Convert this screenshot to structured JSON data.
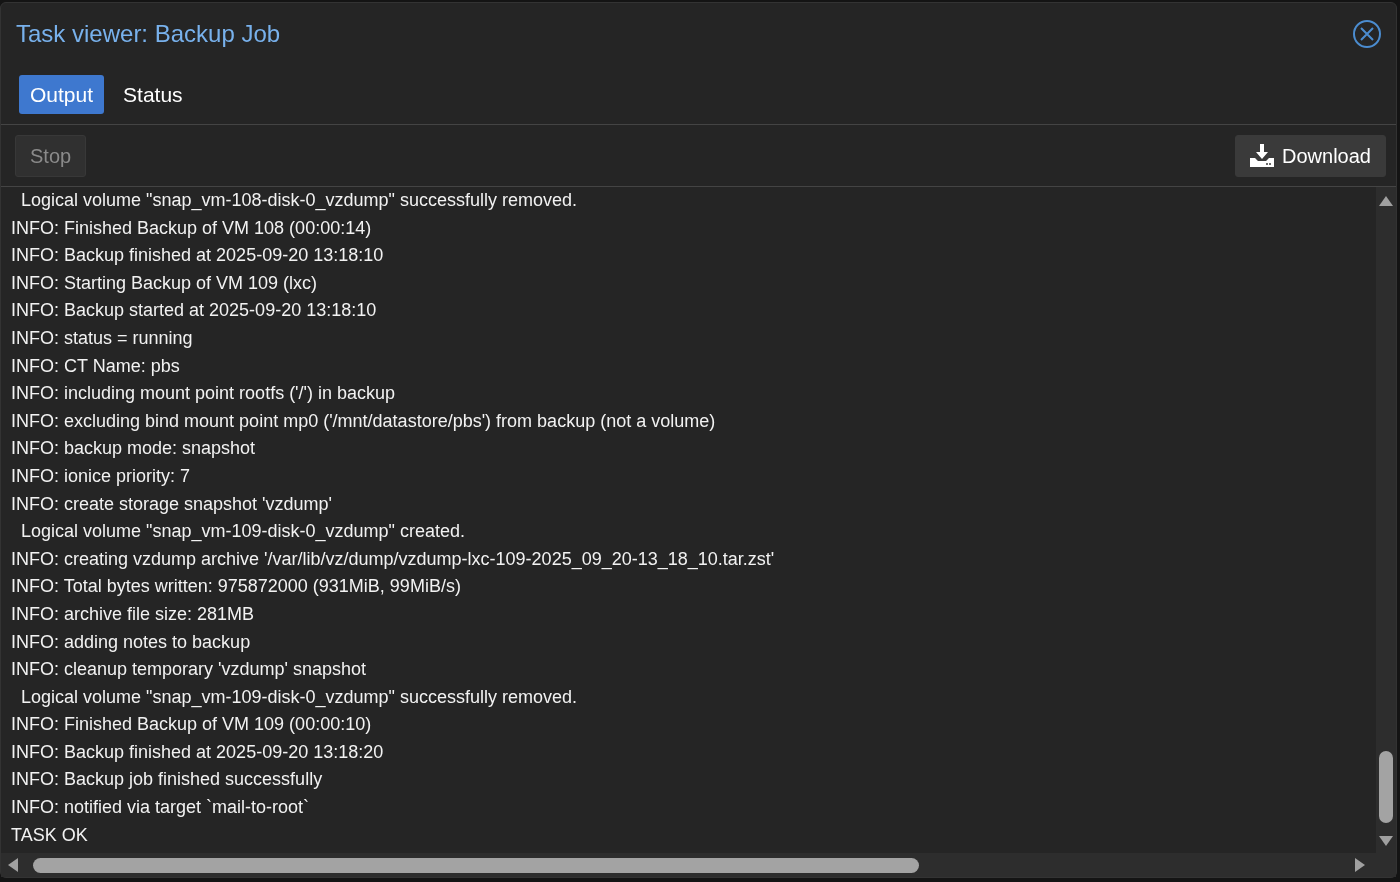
{
  "window": {
    "title": "Task viewer: Backup Job"
  },
  "tabs": [
    {
      "label": "Output",
      "selected": true
    },
    {
      "label": "Status",
      "selected": false
    }
  ],
  "toolbar": {
    "stop": {
      "label": "Stop",
      "disabled": true
    },
    "download": {
      "label": "Download",
      "disabled": false
    }
  },
  "log": [
    "  Logical volume \"snap_vm-108-disk-0_vzdump\" successfully removed.",
    "INFO: Finished Backup of VM 108 (00:00:14)",
    "INFO: Backup finished at 2025-09-20 13:18:10",
    "INFO: Starting Backup of VM 109 (lxc)",
    "INFO: Backup started at 2025-09-20 13:18:10",
    "INFO: status = running",
    "INFO: CT Name: pbs",
    "INFO: including mount point rootfs ('/') in backup",
    "INFO: excluding bind mount point mp0 ('/mnt/datastore/pbs') from backup (not a volume)",
    "INFO: backup mode: snapshot",
    "INFO: ionice priority: 7",
    "INFO: create storage snapshot 'vzdump'",
    "  Logical volume \"snap_vm-109-disk-0_vzdump\" created.",
    "INFO: creating vzdump archive '/var/lib/vz/dump/vzdump-lxc-109-2025_09_20-13_18_10.tar.zst'",
    "INFO: Total bytes written: 975872000 (931MiB, 99MiB/s)",
    "INFO: archive file size: 281MB",
    "INFO: adding notes to backup",
    "INFO: cleanup temporary 'vzdump' snapshot",
    "  Logical volume \"snap_vm-109-disk-0_vzdump\" successfully removed.",
    "INFO: Finished Backup of VM 109 (00:00:10)",
    "INFO: Backup finished at 2025-09-20 13:18:20",
    "INFO: Backup job finished successfully",
    "INFO: notified via target `mail-to-root`",
    "TASK OK"
  ]
}
